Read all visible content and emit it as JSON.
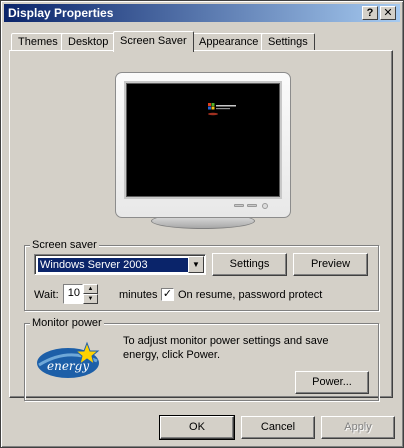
{
  "window": {
    "title": "Display Properties",
    "help_btn": "?",
    "close_btn": "✕"
  },
  "tabs": [
    {
      "label": "Themes",
      "active": false
    },
    {
      "label": "Desktop",
      "active": false
    },
    {
      "label": "Screen Saver",
      "active": true
    },
    {
      "label": "Appearance",
      "active": false
    },
    {
      "label": "Settings",
      "active": false
    }
  ],
  "screen_saver": {
    "group_label": "Screen saver",
    "selected": "Windows Server 2003",
    "settings_btn": "Settings",
    "preview_btn": "Preview",
    "wait_label": "Wait:",
    "wait_value": "10",
    "minutes_label": "minutes",
    "resume_checked": true,
    "resume_label": "On resume, password protect"
  },
  "monitor_power": {
    "group_label": "Monitor power",
    "description": "To adjust monitor power settings and save energy, click Power.",
    "power_btn": "Power..."
  },
  "footer": {
    "ok": "OK",
    "cancel": "Cancel",
    "apply": "Apply",
    "apply_disabled": true
  },
  "colors": {
    "title_start": "#0a246a",
    "title_end": "#a6caf0",
    "face": "#d4d0c8",
    "selection": "#0a246a"
  },
  "icons": {
    "help": "question-mark-icon",
    "close": "close-icon",
    "dropdown": "chevron-down-icon",
    "energy": "energy-star-logo"
  }
}
